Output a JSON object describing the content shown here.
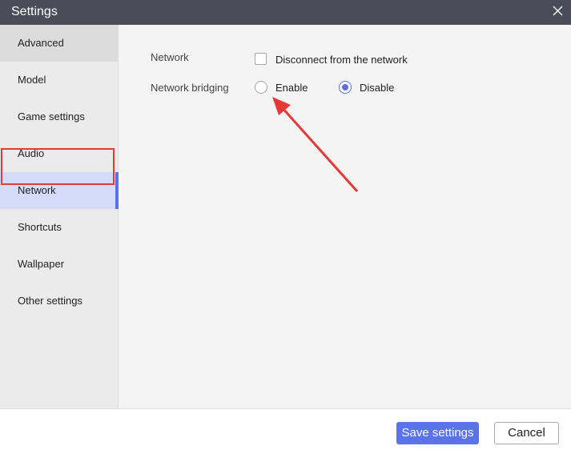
{
  "window": {
    "title": "Settings",
    "close_icon": "close-icon"
  },
  "sidebar": {
    "items": [
      {
        "label": "Advanced"
      },
      {
        "label": "Model"
      },
      {
        "label": "Game settings"
      },
      {
        "label": "Audio"
      },
      {
        "label": "Network"
      },
      {
        "label": "Shortcuts"
      },
      {
        "label": "Wallpaper"
      },
      {
        "label": "Other settings"
      }
    ],
    "selected": "Network"
  },
  "network": {
    "network_label": "Network",
    "disconnect_label": "Disconnect from the network",
    "disconnect_checked": false,
    "bridging_label": "Network bridging",
    "enable_label": "Enable",
    "disable_label": "Disable",
    "bridging_value": "Disable"
  },
  "footer": {
    "save_label": "Save settings",
    "cancel_label": "Cancel"
  },
  "colors": {
    "accent": "#5b6ee8",
    "titlebar": "#4a4d57",
    "annotation": "#e53935"
  }
}
